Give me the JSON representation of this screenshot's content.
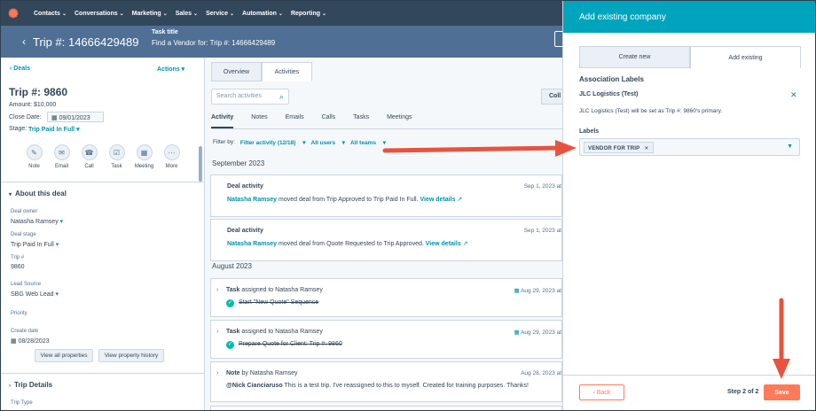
{
  "nav": {
    "items": [
      "Contacts",
      "Conversations",
      "Marketing",
      "Sales",
      "Service",
      "Automation",
      "Reporting"
    ],
    "logo_glyph": "✺"
  },
  "header": {
    "title": "Trip #: 14666429489",
    "task_label": "Task title",
    "task_value": "Find a Vendor for: Trip #: 14666429489"
  },
  "left": {
    "deals_link": "Deals",
    "actions_link": "Actions",
    "title": "Trip #: 9860",
    "amount": "Amount: $10,000",
    "close_date_label": "Close Date:",
    "close_date_value": "09/01/2023",
    "stage_label": "Stage:",
    "stage_value": "Trip Paid In Full",
    "action_buttons": [
      "Note",
      "Email",
      "Call",
      "Task",
      "Meeting",
      "More"
    ],
    "about_heading": "About this deal",
    "props": {
      "owner_label": "Deal owner",
      "owner_value": "Natasha Ramsey",
      "stage_label": "Deal stage",
      "stage_value": "Trip Paid In Full",
      "trip_label": "Trip #",
      "trip_value": "9860",
      "lead_label": "Lead Source",
      "lead_value": "SBG Web Lead",
      "priority_label": "Priority",
      "create_label": "Create date",
      "create_value": "08/28/2023"
    },
    "view_all": "View all properties",
    "view_history": "View property history",
    "trip_details": "Trip Details",
    "trip_type": "Trip Type"
  },
  "middle": {
    "tabs": [
      "Overview",
      "Activities"
    ],
    "search_placeholder": "Search activities",
    "col_btn": "Coll",
    "subtabs": [
      "Activity",
      "Notes",
      "Emails",
      "Calls",
      "Tasks",
      "Meetings"
    ],
    "filter_label": "Filter by:",
    "filter_activity": "Filter activity (12/18)",
    "all_users": "All users",
    "all_teams": "All teams",
    "month1": "September 2023",
    "month2": "August 2023",
    "cards": [
      {
        "title": "Deal activity",
        "user": "Natasha Ramsey",
        "text": "moved deal from Trip Approved to Trip Paid In Full.",
        "link": "View details",
        "date": "Sep 1, 2023 at"
      },
      {
        "title": "Deal activity",
        "user": "Natasha Ramsey",
        "text": "moved deal from Quote Requested to Trip Approved.",
        "link": "View details",
        "date": "Sep 1, 2023 at"
      },
      {
        "title": "Task",
        "user": "assigned to Natasha Ramsey",
        "text": "Start \"New Quote\" Sequence",
        "date": "Aug 29, 2023 at"
      },
      {
        "title": "Task",
        "user": "assigned to Natasha Ramsey",
        "text": "Prepare Quote for Client: Trip #: 9860",
        "date": "Aug 29, 2023 at"
      },
      {
        "title": "Note",
        "user": "by Natasha Ramsey",
        "text": "This is a test trip. I've reassigned to this to myself. Created for training purposes. Thanks!",
        "mention": "@Nick Cianciaruso",
        "date": "Aug 28, 2023 at"
      }
    ]
  },
  "panel": {
    "title": "Add existing company",
    "tab_create": "Create new",
    "tab_existing": "Add existing",
    "assoc_title": "Association Labels",
    "company": "JLC Logistics (Test)",
    "primary_note": "JLC Logistics (Test) will be set as Trip #: 9860's primary.",
    "labels_label": "Labels",
    "chip": "VENDOR FOR TRIP",
    "back": "Back",
    "step": "Step 2 of 2",
    "save": "Save"
  },
  "colors": {
    "nav": "#33475b",
    "header": "#4f6f94",
    "panel_header": "#00a4bd",
    "accent": "#ff7a59",
    "link": "#0091ae",
    "annotation_arrow": "#e8533f"
  }
}
